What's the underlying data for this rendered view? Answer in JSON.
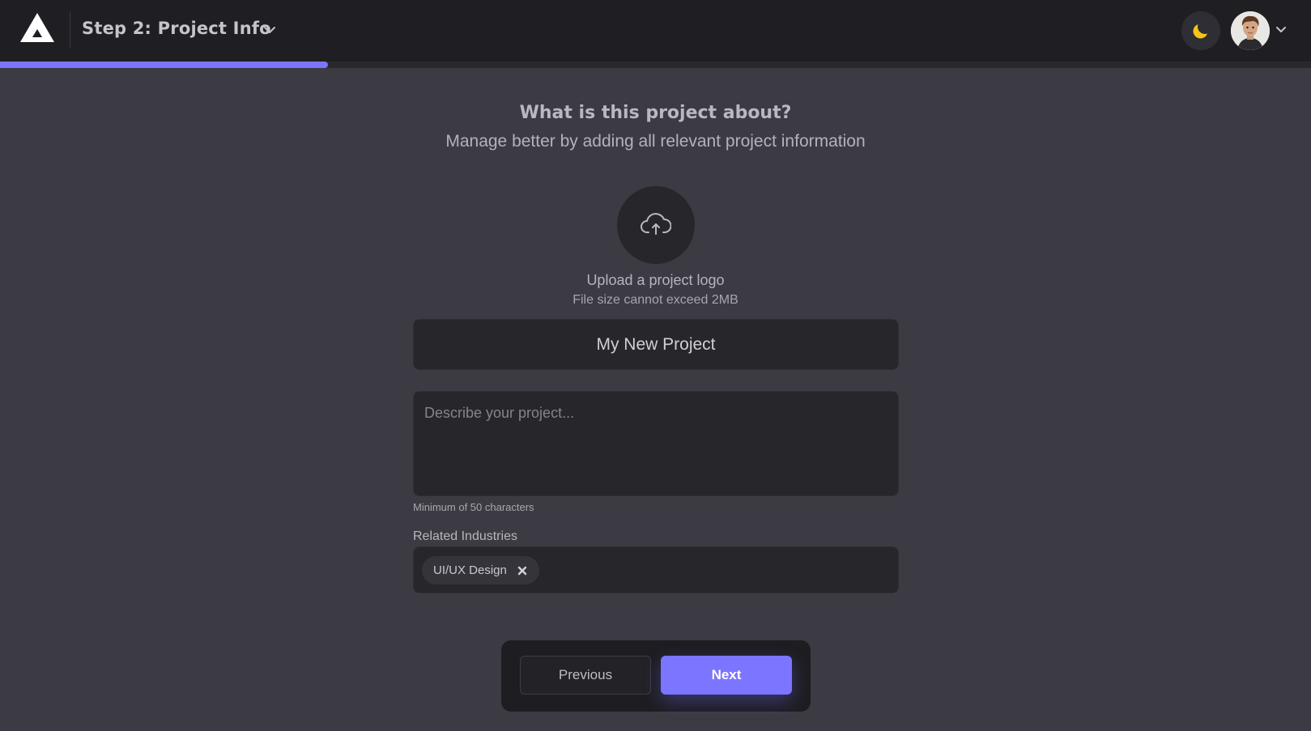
{
  "header": {
    "step_title": "Step 2: Project Info",
    "progress_fraction": 0.25
  },
  "main": {
    "heading": "What is this project about?",
    "subheading": "Manage better by adding all relevant project information",
    "upload": {
      "label": "Upload a project logo",
      "hint": "File size cannot exceed 2MB"
    },
    "project_name": {
      "value": "My New Project"
    },
    "description": {
      "value": "",
      "placeholder": "Describe your project...",
      "hint": "Minimum of 50 characters"
    },
    "industries": {
      "label": "Related Industries",
      "tags": [
        "UI/UX Design"
      ]
    }
  },
  "footer": {
    "previous_label": "Previous",
    "next_label": "Next"
  },
  "colors": {
    "accent": "#7b75ff",
    "background": "#3c3b43",
    "topbar": "#1f1e22",
    "field": "#27262b",
    "moon": "#f5c518"
  },
  "icons": {
    "logo": "triangle-logo-icon",
    "step_menu": "chevron-down-icon",
    "theme": "moon-icon",
    "upload": "cloud-upload-icon",
    "tag_remove": "close-icon"
  }
}
